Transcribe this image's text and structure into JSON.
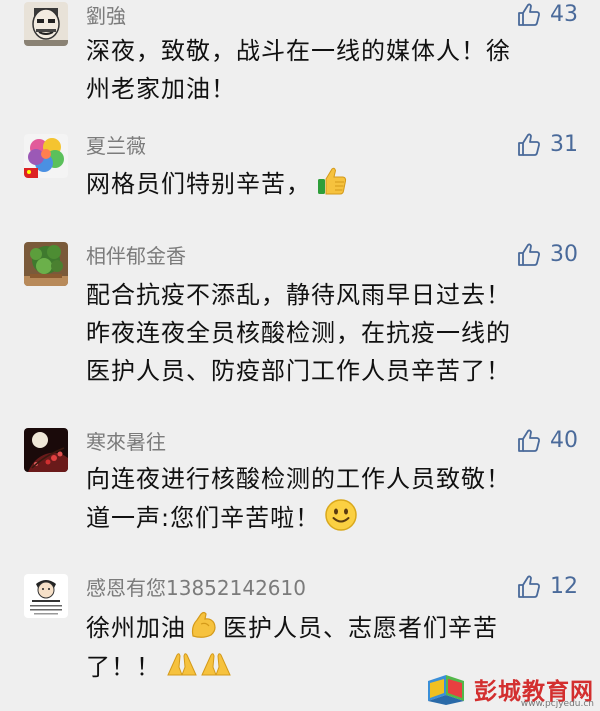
{
  "comments": [
    {
      "username": "劉強",
      "likes": "43",
      "lines": [
        "深夜，致敬，战斗在一线的媒体人！徐",
        "州老家加油！"
      ]
    },
    {
      "username": "夏兰薇",
      "likes": "31",
      "lines": [
        "网格员们特别辛苦，"
      ]
    },
    {
      "username": "相伴郁金香",
      "likes": "30",
      "lines": [
        "配合抗疫不添乱，静待风雨早日过去！",
        "昨夜连夜全员核酸检测，在抗疫一线的",
        "医护人员、防疫部门工作人员辛苦了！"
      ]
    },
    {
      "username": "寒來暑往",
      "likes": "40",
      "lines": [
        "向连夜进行核酸检测的工作人员致敬！",
        "道一声:您们辛苦啦！"
      ]
    },
    {
      "username": "感恩有您13852142610",
      "likes": "12",
      "line1a": "徐州加油",
      "line1b": "医护人员、志愿者们辛苦",
      "line2": "了！！"
    }
  ],
  "watermark": {
    "name": "彭城教育网",
    "url": "www.pcjyedu.cn"
  },
  "colors": {
    "background": "#efefef",
    "username": "#7b7b7b",
    "like": "#4a6a9a",
    "text": "#111111",
    "watermark": "#d32f2f"
  }
}
